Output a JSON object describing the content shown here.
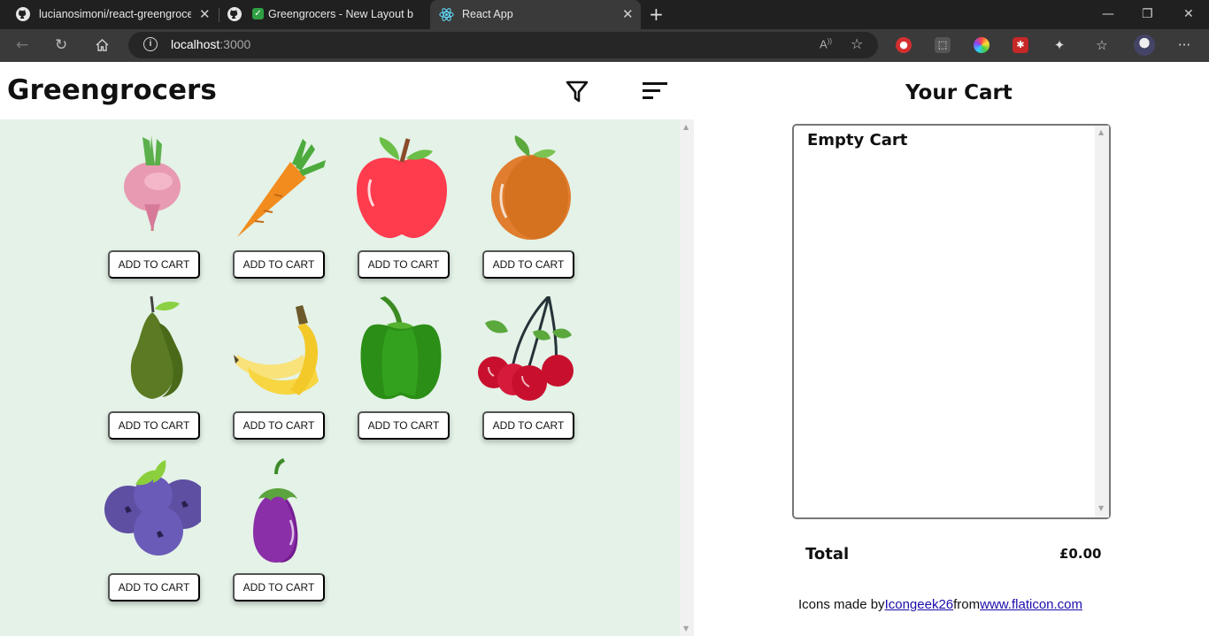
{
  "browser": {
    "tabs": [
      {
        "title": "lucianosimoni/react-greengrocer",
        "icon": "github-icon"
      },
      {
        "title": "Greengrocers - New Layout b",
        "icon": "github-icon"
      },
      {
        "title": "React App",
        "icon": "react-icon"
      }
    ],
    "address": {
      "host": "localhost",
      "port": ":3000"
    }
  },
  "app": {
    "title": "Greengrocers",
    "filter_icon": "filter-icon",
    "sort_icon": "sort-icon",
    "add_label": "ADD TO CART",
    "products": [
      {
        "name": "beetroot",
        "icon": "beetroot-icon"
      },
      {
        "name": "carrot",
        "icon": "carrot-icon"
      },
      {
        "name": "apple",
        "icon": "apple-icon"
      },
      {
        "name": "apricot",
        "icon": "apricot-icon"
      },
      {
        "name": "avocado",
        "icon": "avocado-icon"
      },
      {
        "name": "bananas",
        "icon": "banana-icon"
      },
      {
        "name": "bell pepper",
        "icon": "pepper-icon"
      },
      {
        "name": "berry",
        "icon": "cherry-icon"
      },
      {
        "name": "blueberry",
        "icon": "blueberry-icon"
      },
      {
        "name": "eggplant",
        "icon": "eggplant-icon"
      }
    ]
  },
  "cart": {
    "title": "Your Cart",
    "empty_text": "Empty Cart",
    "total_label": "Total",
    "total_value": "£0.00"
  },
  "credit": {
    "prefix": "Icons made by",
    "author": "Icongeek26",
    "middle": "from",
    "site": "www.flaticon.com"
  },
  "colors": {
    "grid_bg": "#e4f2e7",
    "link": "#1a0dab"
  }
}
